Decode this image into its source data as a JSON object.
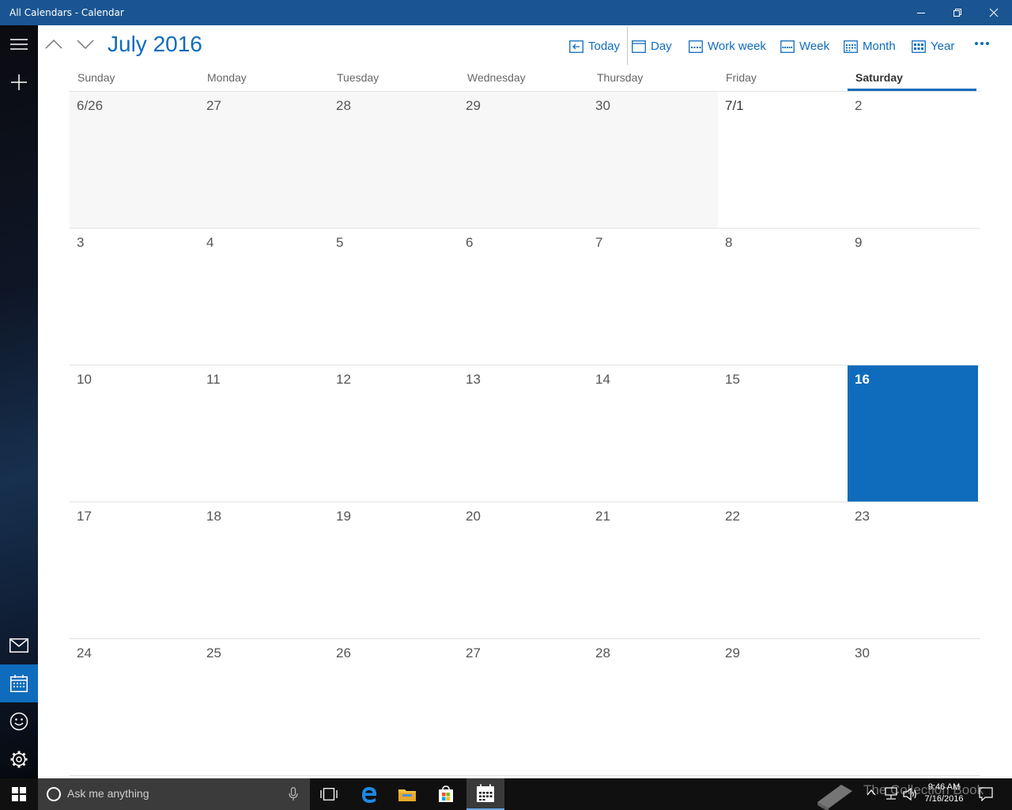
{
  "window": {
    "title": "All Calendars - Calendar"
  },
  "rail": {
    "menu_icon": "hamburger-icon",
    "new_event_icon": "plus-icon",
    "bottom": [
      "mail-icon",
      "calendar-icon",
      "people-icon",
      "gear-icon"
    ]
  },
  "header": {
    "month_title": "July 2016",
    "views": {
      "today": "Today",
      "day": "Day",
      "work_week": "Work week",
      "week": "Week",
      "month": "Month",
      "year": "Year"
    }
  },
  "weekdays": [
    "Sunday",
    "Monday",
    "Tuesday",
    "Wednesday",
    "Thursday",
    "Friday",
    "Saturday"
  ],
  "selected_weekday": "Saturday",
  "weeks": [
    [
      "6/26",
      "27",
      "28",
      "29",
      "30",
      "7/1",
      "2"
    ],
    [
      "3",
      "4",
      "5",
      "6",
      "7",
      "8",
      "9"
    ],
    [
      "10",
      "11",
      "12",
      "13",
      "14",
      "15",
      "16"
    ],
    [
      "17",
      "18",
      "19",
      "20",
      "21",
      "22",
      "23"
    ],
    [
      "24",
      "25",
      "26",
      "27",
      "28",
      "29",
      "30"
    ]
  ],
  "today": "16",
  "taskbar": {
    "search_placeholder": "Ask me anything",
    "time": "9:46 AM",
    "date": "7/16/2016",
    "watermark": "The Collection Book"
  },
  "colors": {
    "accent": "#0f6cbd",
    "titlebar": "#1a5592",
    "taskbar": "#101010"
  }
}
